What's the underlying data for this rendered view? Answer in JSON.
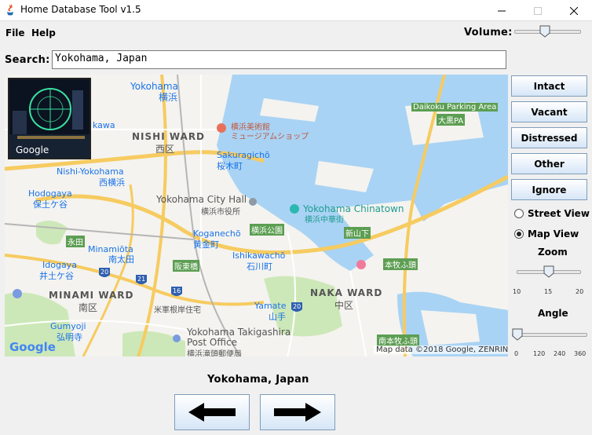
{
  "window": {
    "title": "Home Database Tool v1.5"
  },
  "menu": {
    "file": "File",
    "help": "Help"
  },
  "volume": {
    "label": "Volume:",
    "level_fraction": 0.45
  },
  "search": {
    "label": "Search:",
    "value": "Yokohama, Japan"
  },
  "map": {
    "thumbnail_brand": "Google",
    "google_logo": "Google",
    "attribution": "Map data ©2018 Google, ZENRIN",
    "labels": {
      "yokohama": "Yokohama",
      "yokohama_jp": "横浜",
      "nishi_ward": "NISHI WARD",
      "nishi_ward_jp": "西区",
      "kawa": "kawa",
      "nishi_yokohama": "Nishi-Yokohama",
      "nishi_yokohama_jp": "西横浜",
      "hodogaya": "Hodogaya",
      "hodogaya_jp": "保土ケ谷",
      "museum_jp1": "横浜美術館",
      "museum_jp2": "ミュージアムショップ",
      "sakuragicho": "Sakuragichō",
      "sakuragicho_jp": "桜木町",
      "city_hall": "Yokohama City Hall",
      "city_hall_jp": "横浜市役所",
      "chinatown": "Yokohama Chinatown",
      "chinatown_jp": "横浜中華街",
      "koganecho": "Koganechō",
      "koganecho_jp": "黄金町",
      "yokohama_park_jp": "横浜公園",
      "eiraku_jp": "永田",
      "minamiota": "Minamiōta",
      "minamiota_jp": "南太田",
      "ishikawacho": "Ishikawachō",
      "ishikawacho_jp": "石川町",
      "sakaibashi_jp": "阪東橋",
      "shin_yamashita_jp": "新山下",
      "honmoku_jp": "本牧ふ頭",
      "idogaya": "Idogaya",
      "idogaya_jp": "井土ケ谷",
      "minami_ward": "MINAMI WARD",
      "minami_ward_jp": "南区",
      "naka_ward": "NAKA WARD",
      "naka_ward_jp": "中区",
      "yamate": "Yamate",
      "yamate_jp": "山手",
      "hospital_jp": "米軍根岸住宅",
      "gumyoji": "Gumyoji",
      "gumyoji_jp": "弘明寺",
      "takigashira1": "Yokohama Takigashira",
      "takigashira2": "Post Office",
      "takigashira_jp": "横浜滝頭郵便局",
      "honmoku_south_jp": "南本牧ふ頭",
      "daikoku": "Daikoku Parking Area",
      "daikoku_jp": "大黒PA",
      "route_21": "21",
      "route_16": "16",
      "route_20": "20",
      "route_20b": "20"
    }
  },
  "side_buttons": [
    "Intact",
    "Vacant",
    "Distressed",
    "Other",
    "Ignore"
  ],
  "view_mode": {
    "street": {
      "label": "Street View",
      "selected": false
    },
    "map": {
      "label": "Map View",
      "selected": true
    }
  },
  "zoom": {
    "label": "Zoom",
    "ticks": [
      "10",
      "15",
      "20"
    ],
    "value": 15
  },
  "angle": {
    "label": "Angle",
    "ticks": [
      "0",
      "120",
      "240",
      "360"
    ],
    "value": 0
  },
  "location_label": "Yokohama, Japan",
  "nav": {
    "prev_icon": "arrow-left-icon",
    "next_icon": "arrow-right-icon"
  },
  "colors": {
    "water": "#a9d3f4",
    "park": "#cde8b8",
    "road_major": "#f6cb60",
    "button_top": "#ffffff",
    "button_bottom": "#d6e6f7"
  }
}
